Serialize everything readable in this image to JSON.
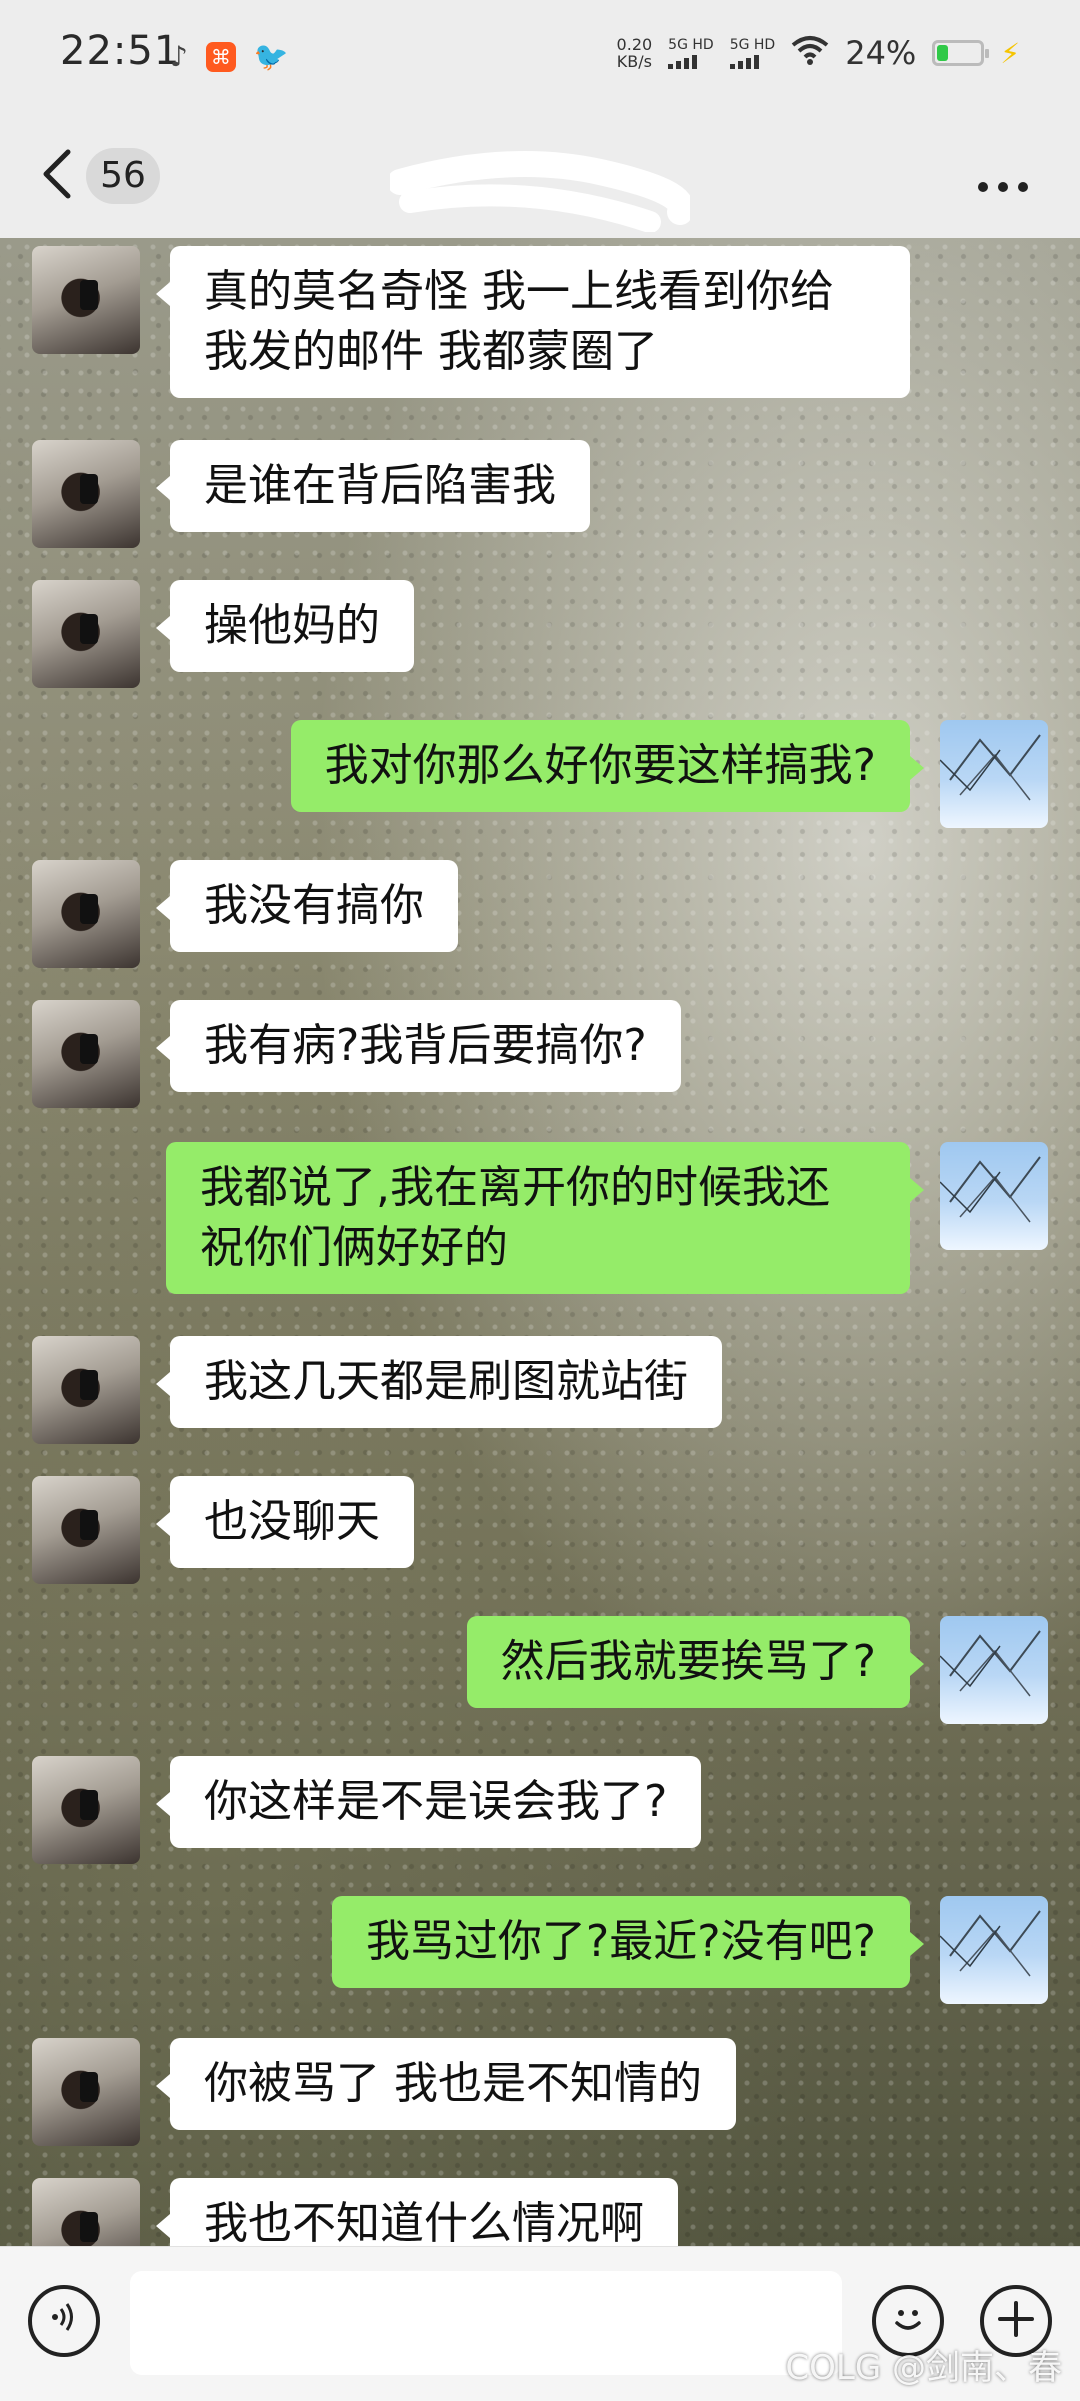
{
  "status_bar": {
    "time": "22:51",
    "net_speed_value": "0.20",
    "net_speed_unit": "KB/s",
    "signal1_label": "5G HD",
    "signal2_label": "5G HD",
    "battery_percent": "24%",
    "battery_level": 0.24,
    "battery_color": "#30c948"
  },
  "header": {
    "unread_count": "56",
    "title": "",
    "back_icon": "chevron-left-icon",
    "more_icon": "more-horizontal-icon"
  },
  "messages": [
    {
      "side": "left",
      "text_line1": "真的莫名奇怪 我一上线看到你给",
      "text_line2": "我发的邮件 我都蒙圈了"
    },
    {
      "side": "left",
      "text": "是谁在背后陷害我"
    },
    {
      "side": "left",
      "text": "操他妈的"
    },
    {
      "side": "right",
      "text": "我对你那么好你要这样搞我?"
    },
    {
      "side": "left",
      "text": "我没有搞你"
    },
    {
      "side": "left",
      "text": "我有病?我背后要搞你?"
    },
    {
      "side": "right",
      "text_line1": "我都说了,我在离开你的时候我还",
      "text_line2": "祝你们俩好好的"
    },
    {
      "side": "left",
      "text": "我这几天都是刷图就站街"
    },
    {
      "side": "left",
      "text": "也没聊天"
    },
    {
      "side": "right",
      "text": "然后我就要挨骂了?"
    },
    {
      "side": "left",
      "text": "你这样是不是误会我了?"
    },
    {
      "side": "right",
      "text": "我骂过你了?最近?没有吧?"
    },
    {
      "side": "left",
      "text": "你被骂了 我也是不知情的"
    },
    {
      "side": "left",
      "text": "我也不知道什么情况啊"
    }
  ],
  "input_bar": {
    "voice_icon": "voice-icon",
    "emoji_icon": "emoji-icon",
    "plus_icon": "plus-icon",
    "placeholder": ""
  },
  "watermark": "COLG @剑南、春",
  "colors": {
    "outgoing_bubble": "#95ec69",
    "incoming_bubble": "#ffffff",
    "header_bg": "#ededed"
  }
}
